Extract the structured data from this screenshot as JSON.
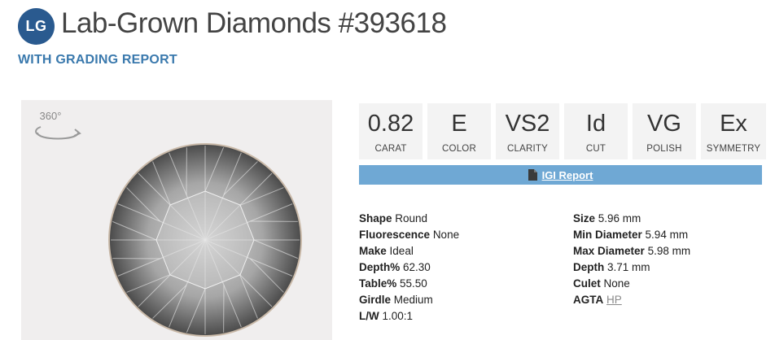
{
  "header": {
    "logo": "LG",
    "title": "Lab-Grown Diamonds #393618",
    "subtitle": "WITH GRADING REPORT"
  },
  "viewer": {
    "rotate_label": "360°"
  },
  "specs": [
    {
      "value": "0.82",
      "label": "CARAT"
    },
    {
      "value": "E",
      "label": "COLOR"
    },
    {
      "value": "VS2",
      "label": "CLARITY"
    },
    {
      "value": "Id",
      "label": "CUT"
    },
    {
      "value": "VG",
      "label": "POLISH"
    },
    {
      "value": "Ex",
      "label": "SYMMETRY"
    }
  ],
  "report": {
    "label": "IGI Report",
    "icon": "document-icon"
  },
  "details_left": [
    {
      "label": "Shape",
      "value": "Round"
    },
    {
      "label": "Fluorescence",
      "value": "None"
    },
    {
      "label": "Make",
      "value": "Ideal"
    },
    {
      "label": "Depth%",
      "value": "62.30"
    },
    {
      "label": "Table%",
      "value": "55.50"
    },
    {
      "label": "Girdle",
      "value": "Medium"
    },
    {
      "label": "L/W",
      "value": "1.00:1"
    }
  ],
  "details_right": [
    {
      "label": "Size",
      "value": "5.96 mm"
    },
    {
      "label": "Min Diameter",
      "value": "5.94 mm"
    },
    {
      "label": "Max Diameter",
      "value": "5.98 mm"
    },
    {
      "label": "Depth",
      "value": "3.71 mm"
    },
    {
      "label": "Culet",
      "value": "None"
    },
    {
      "label": "AGTA",
      "value": "HP"
    }
  ],
  "colors": {
    "logo_bg": "#2a5a8f",
    "subtitle": "#3a79ad",
    "report_bar": "#6fa8d4",
    "spec_box_bg": "#f3f3f3"
  }
}
